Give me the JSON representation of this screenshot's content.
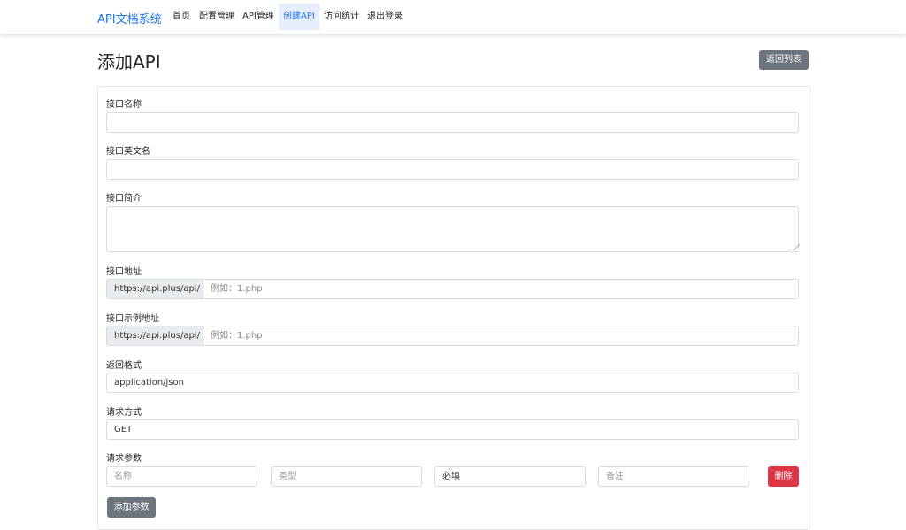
{
  "nav": {
    "brand": "API文档系统",
    "items": [
      {
        "label": "首页"
      },
      {
        "label": "配置管理"
      },
      {
        "label": "API管理"
      },
      {
        "label": "创建API"
      },
      {
        "label": "访问统计"
      },
      {
        "label": "退出登录"
      }
    ],
    "active_item": "创建API"
  },
  "header": {
    "title": "添加API",
    "back_button": "返回列表"
  },
  "form": {
    "name": {
      "label": "接口名称",
      "value": ""
    },
    "en_name": {
      "label": "接口英文名",
      "value": ""
    },
    "intro": {
      "label": "接口简介",
      "value": ""
    },
    "url": {
      "label": "接口地址",
      "prefix": "https://api.plus/api/",
      "placeholder": "例如：1.php"
    },
    "example_url": {
      "label": "接口示例地址",
      "prefix": "https://api.plus/api/",
      "placeholder": "例如：1.php"
    },
    "format": {
      "label": "返回格式",
      "value": "application/json"
    },
    "method": {
      "label": "请求方式",
      "value": "GET"
    },
    "params": {
      "label": "请求参数",
      "name_placeholder": "名称",
      "type_placeholder": "类型",
      "required_value": "必填",
      "note_placeholder": "备注",
      "delete_button": "删除",
      "add_button": "添加参数"
    }
  },
  "colors": {
    "brand": "#1a73e8",
    "secondary_button": "#6c757d",
    "danger_button": "#dc3545"
  }
}
